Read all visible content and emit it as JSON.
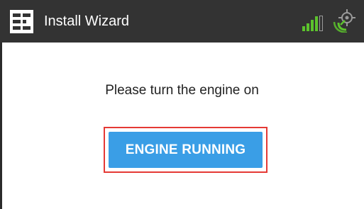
{
  "window": {
    "title": "Install Wizard"
  },
  "icons": {
    "app": "app-logo-icon",
    "signal": "signal-strength-icon",
    "gps": "gps-location-icon"
  },
  "main": {
    "prompt": "Please turn the engine on",
    "button_label": "ENGINE RUNNING"
  },
  "colors": {
    "titlebar_bg": "#333333",
    "signal_green": "#5cc32c",
    "button_bg": "#3a9ee6",
    "highlight_border": "#e53935"
  }
}
